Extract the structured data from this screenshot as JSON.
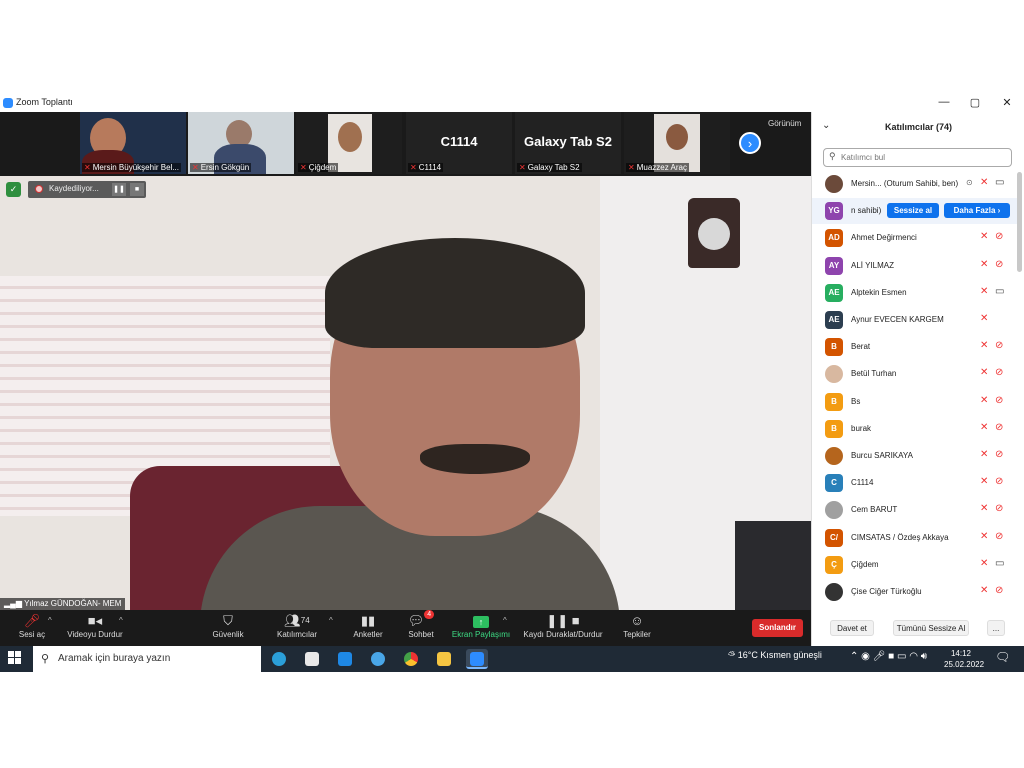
{
  "window": {
    "title": "Zoom Toplantı",
    "minimize": "—",
    "maximize": "▢",
    "close": "✕"
  },
  "gallery": {
    "view_label": "Görünüm",
    "next": "›",
    "tiles": [
      {
        "name": "Mersin Büyükşehir Bel..."
      },
      {
        "name": "Ersin Gökgün"
      },
      {
        "name": "Çiğdem"
      },
      {
        "name": "C1114",
        "big": "C1114"
      },
      {
        "name": "Galaxy Tab S2",
        "big": "Galaxy Tab S2"
      },
      {
        "name": "Muazzez Araç"
      }
    ]
  },
  "recording": {
    "label": "Kaydediliyor...",
    "pause": "❚❚",
    "stop": "■"
  },
  "speaker": {
    "name": "Yılmaz GÜNDOĞAN- MEM"
  },
  "toolbar": {
    "mute": "Sesi aç",
    "video": "Videoyu Durdur",
    "security": "Güvenlik",
    "participants": "Katılımcılar",
    "participants_count": "74",
    "polls": "Anketler",
    "chat": "Sohbet",
    "chat_badge": "4",
    "share": "Ekran Paylaşımı",
    "record": "Kaydı Duraklat/Durdur",
    "reactions": "Tepkiler",
    "end": "Sonlandır"
  },
  "panel": {
    "title": "Katılımcılar (74)",
    "search_placeholder": "Katılımcı bul",
    "mute_btn": "Sessize al",
    "more_btn": "Daha Fazla ›",
    "invite": "Davet et",
    "mute_all": "Tümünü Sessize Al",
    "more": "...",
    "participants": [
      {
        "initials": "",
        "name": "Mersin... (Oturum Sahibi, ben)",
        "color": "#6b4a3a",
        "video": "on"
      },
      {
        "initials": "YG",
        "name": "n sahibi)",
        "color": "#8e44ad",
        "video": "none"
      },
      {
        "initials": "AD",
        "name": "Ahmet Değirmenci",
        "color": "#d35400",
        "video": "off"
      },
      {
        "initials": "AY",
        "name": "ALİ YILMAZ",
        "color": "#8e44ad",
        "video": "off"
      },
      {
        "initials": "AE",
        "name": "Alptekin Esmen",
        "color": "#27ae60",
        "video": "on"
      },
      {
        "initials": "AE",
        "name": "Aynur EVECEN KARGEM",
        "color": "#2c3e50",
        "video": "none"
      },
      {
        "initials": "B",
        "name": "Berat",
        "color": "#d35400",
        "video": "off"
      },
      {
        "initials": "",
        "name": "Betül Turhan",
        "color": "#d8b8a0",
        "video": "off"
      },
      {
        "initials": "B",
        "name": "Bs",
        "color": "#f39c12",
        "video": "off"
      },
      {
        "initials": "B",
        "name": "burak",
        "color": "#f39c12",
        "video": "off"
      },
      {
        "initials": "",
        "name": "Burcu SARIKAYA",
        "color": "#b5651d",
        "video": "off"
      },
      {
        "initials": "C",
        "name": "C1114",
        "color": "#2980b9",
        "video": "off"
      },
      {
        "initials": "",
        "name": "Cem BARUT",
        "color": "#a0a0a0",
        "video": "off"
      },
      {
        "initials": "C/",
        "name": "CIMSATAS / Özdeş Akkaya",
        "color": "#d35400",
        "video": "off"
      },
      {
        "initials": "Ç",
        "name": "Çiğdem",
        "color": "#f39c12",
        "video": "on"
      },
      {
        "initials": "",
        "name": "Çise Ciğer Türkoğlu",
        "color": "#333333",
        "video": "off"
      }
    ]
  },
  "taskbar": {
    "search_placeholder": "Aramak için buraya yazın",
    "weather": "16°C  Kısmen güneşli",
    "time": "14:12",
    "date": "25.02.2022"
  }
}
